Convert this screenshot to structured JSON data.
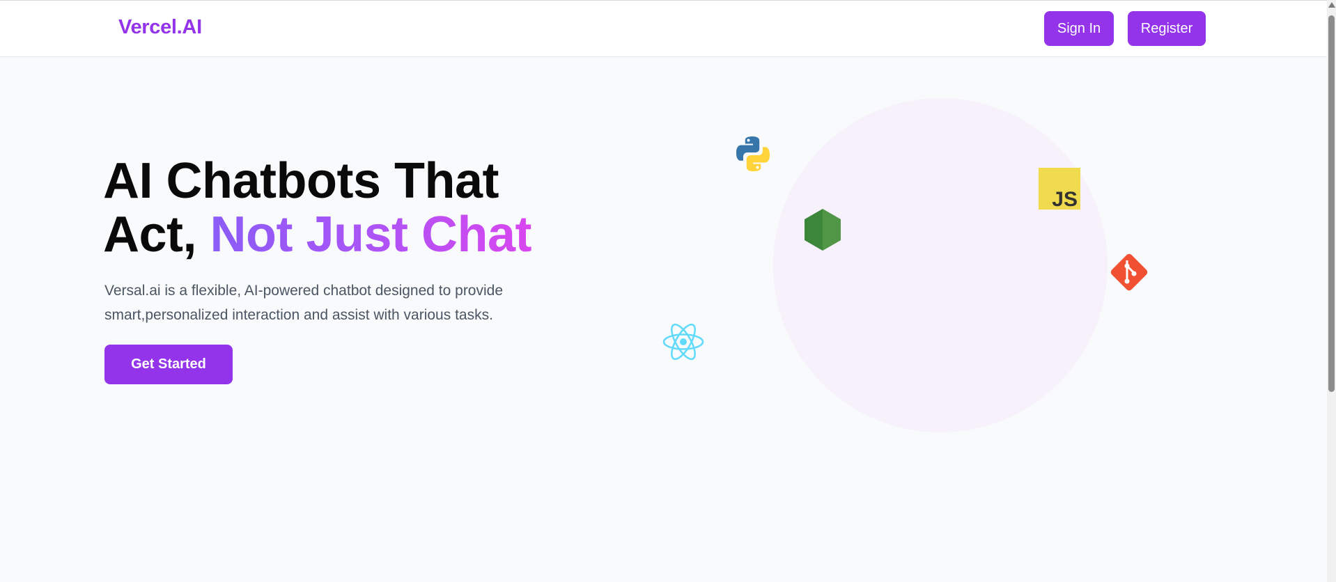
{
  "navbar": {
    "brand": "Vercel.AI",
    "sign_in_label": "Sign In",
    "register_label": "Register"
  },
  "hero": {
    "title_line1": "AI Chatbots That",
    "title_line2_plain": "Act, ",
    "title_line2_highlight": "Not Just Chat",
    "description": "Versal.ai is a flexible, AI-powered chatbot designed to provide smart,personalized interaction and assist with various tasks.",
    "cta_label": "Get Started"
  },
  "tech_icons": {
    "python": "python-icon",
    "javascript": "javascript-icon",
    "javascript_text": "JS",
    "nodejs": "nodejs-icon",
    "git": "git-icon",
    "react": "react-icon"
  },
  "colors": {
    "accent": "#9333ea",
    "gradient_start": "#8b5cf6",
    "gradient_end": "#d946ef",
    "background": "#f9fafb",
    "circle": "#f6f1fb"
  }
}
